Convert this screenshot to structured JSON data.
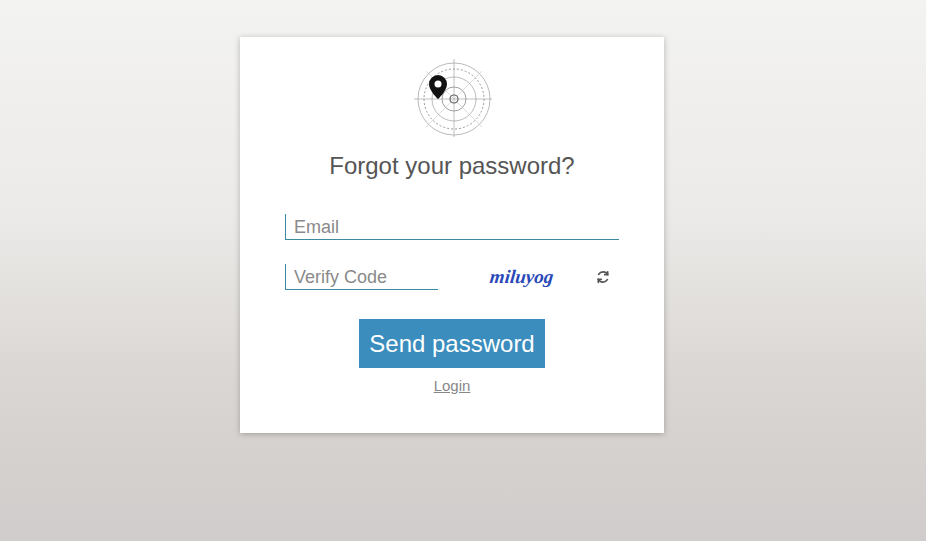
{
  "page": {
    "title": "Forgot your password?"
  },
  "fields": [
    {
      "name": "email",
      "placeholder": "Email",
      "value": ""
    },
    {
      "name": "verify-code",
      "placeholder": "Verify Code",
      "value": ""
    }
  ],
  "captcha": {
    "text": "miluyog"
  },
  "buttons": [
    "Send password"
  ],
  "links": [
    "Login"
  ]
}
